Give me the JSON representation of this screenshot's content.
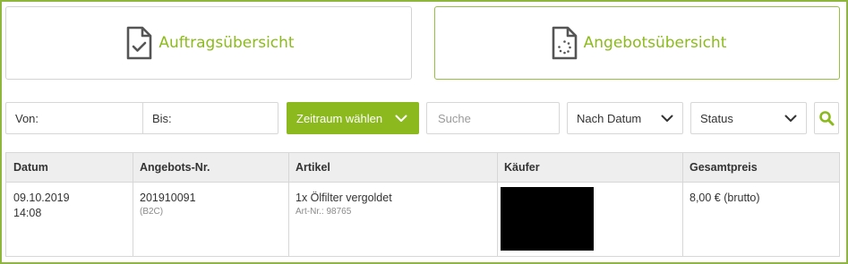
{
  "tiles": {
    "auftrag": {
      "label": "Auftragsübersicht",
      "icon": "document-check-icon"
    },
    "angebot": {
      "label": "Angebotsübersicht",
      "icon": "document-loading-icon"
    }
  },
  "filters": {
    "von_label": "Von:",
    "bis_label": "Bis:",
    "zeitraum_label": "Zeitraum wählen",
    "search_placeholder": "Suche",
    "sort_selected": "Nach Datum",
    "status_selected": "Status",
    "search_button_icon": "magnifier-icon"
  },
  "colors": {
    "accent": "#8cba1e",
    "border": "#d7d7d7",
    "header_bg": "#eeeeee"
  },
  "table": {
    "headers": [
      "Datum",
      "Angebots-Nr.",
      "Artikel",
      "Käufer",
      "Gesamtpreis"
    ],
    "rows": [
      {
        "date": "09.10.2019",
        "time": "14:08",
        "number": "201910091",
        "type": "(B2C)",
        "article": "1x Ölfilter vergoldet",
        "article_no": "Art-Nr.: 98765",
        "buyer": "",
        "price": "8,00 € (brutto)"
      }
    ]
  }
}
